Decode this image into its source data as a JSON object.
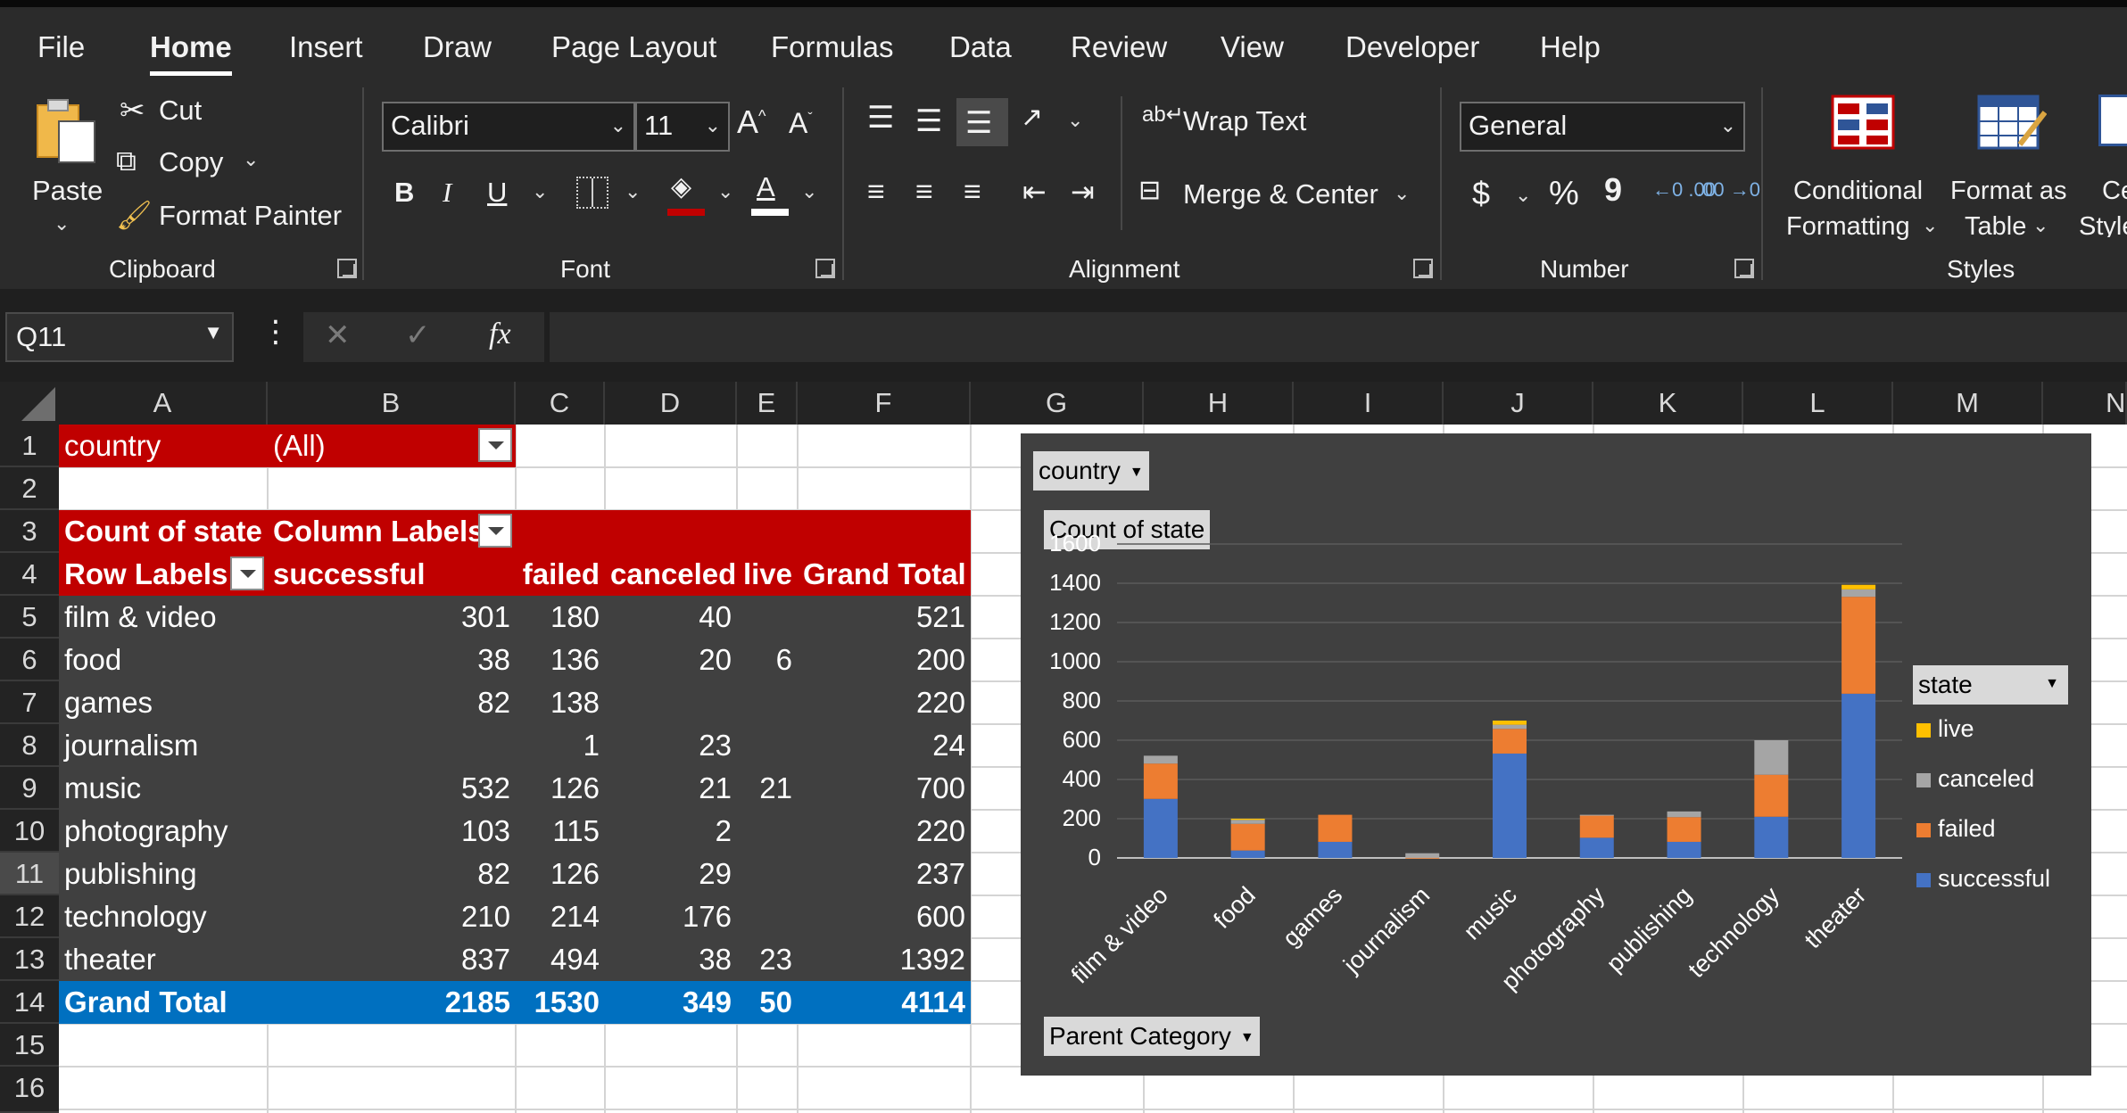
{
  "menu": {
    "tabs": [
      "File",
      "Home",
      "Insert",
      "Draw",
      "Page Layout",
      "Formulas",
      "Data",
      "Review",
      "View",
      "Developer",
      "Help"
    ],
    "active": "Home"
  },
  "ribbon": {
    "clipboard": {
      "paste": "Paste",
      "cut": "Cut",
      "copy": "Copy",
      "format_painter": "Format Painter",
      "group": "Clipboard"
    },
    "font": {
      "name": "Calibri",
      "size": "11",
      "bold": "B",
      "italic": "I",
      "underline": "U",
      "grow": "A",
      "shrink": "A",
      "color_glyph": "A",
      "group": "Font"
    },
    "alignment": {
      "wrap_text": "Wrap Text",
      "merge_center": "Merge & Center",
      "group": "Alignment"
    },
    "number": {
      "format": "General",
      "currency": "$",
      "percent": "%",
      "comma": "9",
      "inc_dec": "←0 .00",
      "dec_dec": ".00 →0",
      "group": "Number"
    },
    "styles": {
      "conditional_1": "Conditional",
      "conditional_2": "Formatting",
      "table_1": "Format as",
      "table_2": "Table",
      "cell_1": "Ce",
      "cell_2": "Style",
      "group": "Styles"
    }
  },
  "formula_bar": {
    "name_box": "Q11",
    "cancel": "✕",
    "enter": "✓",
    "fx": "fx",
    "formula": ""
  },
  "columns": [
    "A",
    "B",
    "C",
    "D",
    "E",
    "F",
    "G",
    "H",
    "I",
    "J",
    "K",
    "L",
    "M",
    "N"
  ],
  "rows": [
    "1",
    "2",
    "3",
    "4",
    "5",
    "6",
    "7",
    "8",
    "9",
    "10",
    "11",
    "12",
    "13",
    "14",
    "15",
    "16"
  ],
  "selected_row": "11",
  "pivot": {
    "filter_label": "country",
    "filter_value": "(All)",
    "count_label": "Count of state",
    "column_labels": "Column Labels",
    "row_labels": "Row Labels",
    "headers": [
      "successful",
      "failed",
      "canceled",
      "live",
      "Grand Total"
    ],
    "data": [
      [
        "film & video",
        "301",
        "180",
        "40",
        "",
        "521"
      ],
      [
        "food",
        "38",
        "136",
        "20",
        "6",
        "200"
      ],
      [
        "games",
        "82",
        "138",
        "",
        "",
        "220"
      ],
      [
        "journalism",
        "",
        "1",
        "23",
        "",
        "24"
      ],
      [
        "music",
        "532",
        "126",
        "21",
        "21",
        "700"
      ],
      [
        "photography",
        "103",
        "115",
        "2",
        "",
        "220"
      ],
      [
        "publishing",
        "82",
        "126",
        "29",
        "",
        "237"
      ],
      [
        "technology",
        "210",
        "214",
        "176",
        "",
        "600"
      ],
      [
        "theater",
        "837",
        "494",
        "38",
        "23",
        "1392"
      ]
    ],
    "grand_total": [
      "Grand Total",
      "2185",
      "1530",
      "349",
      "50",
      "4114"
    ]
  },
  "chart_buttons": {
    "filter": "country",
    "values": "Count of state",
    "axis": "Parent Category",
    "legend": "state"
  },
  "chart_data": {
    "type": "bar",
    "stacked": true,
    "categories": [
      "film & video",
      "food",
      "games",
      "journalism",
      "music",
      "photography",
      "publishing",
      "technology",
      "theater"
    ],
    "series": [
      {
        "name": "successful",
        "color": "#4472c4",
        "values": [
          301,
          38,
          82,
          0,
          532,
          103,
          82,
          210,
          837
        ]
      },
      {
        "name": "failed",
        "color": "#ed7d31",
        "values": [
          180,
          136,
          138,
          1,
          126,
          115,
          126,
          214,
          494
        ]
      },
      {
        "name": "canceled",
        "color": "#a5a5a5",
        "values": [
          40,
          20,
          0,
          23,
          21,
          2,
          29,
          176,
          38
        ]
      },
      {
        "name": "live",
        "color": "#ffc000",
        "values": [
          0,
          6,
          0,
          0,
          21,
          0,
          0,
          0,
          23
        ]
      }
    ],
    "ylim": [
      0,
      1600
    ],
    "yticks": [
      "1600",
      "1400",
      "1200",
      "1000",
      "800",
      "600",
      "400",
      "200",
      "0"
    ],
    "legend_order": [
      "live",
      "canceled",
      "failed",
      "successful"
    ],
    "legend_position": "right",
    "grid": true
  },
  "colors": {
    "pivot_header": "#c00000",
    "grand_total": "#0070c0",
    "pivot_body": "#404040",
    "ribbon": "#2b2b2b"
  }
}
